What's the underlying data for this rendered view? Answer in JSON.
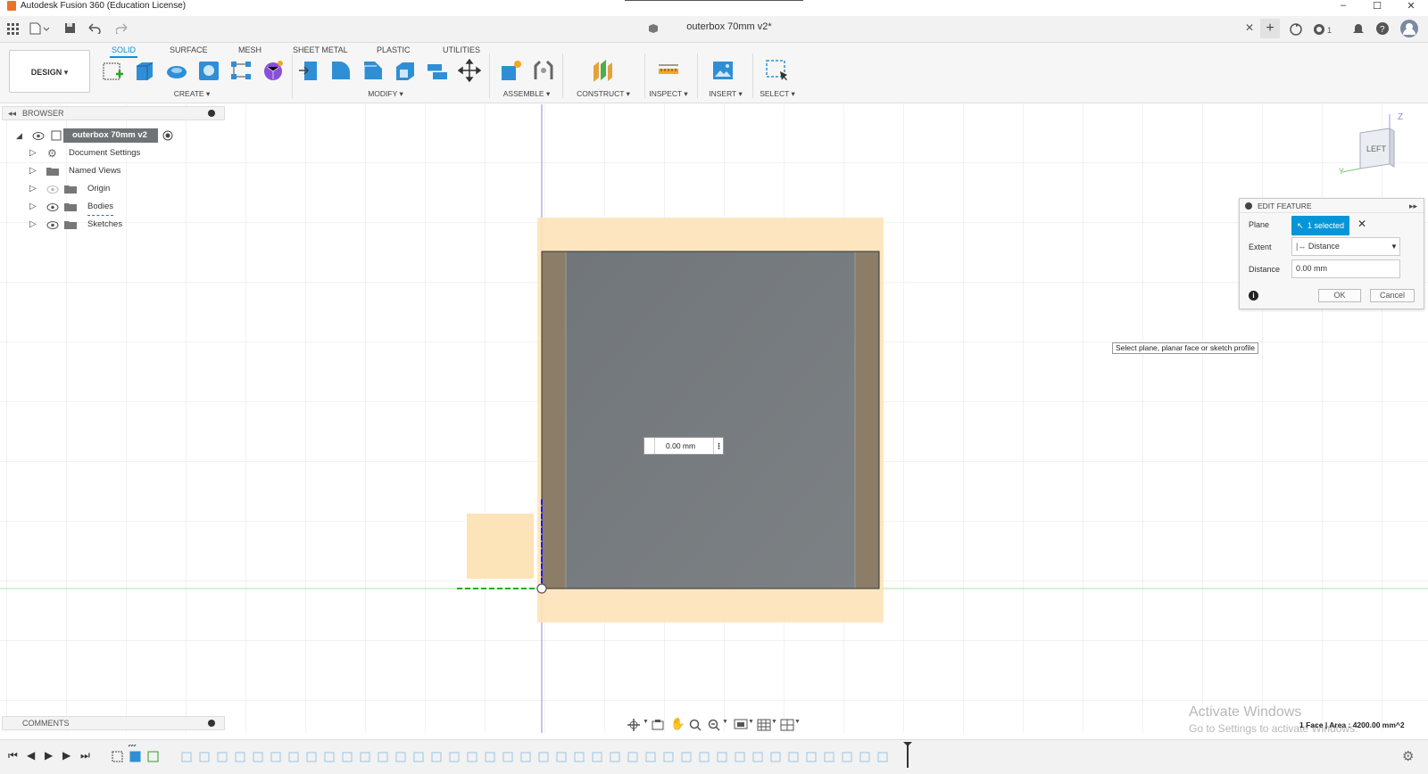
{
  "title_bar": {
    "title": "Autodesk Fusion 360 (Education License)"
  },
  "document_tab": {
    "name": "outerbox 70mm v2*"
  },
  "ribbon": {
    "workspace": "DESIGN",
    "tabs": [
      {
        "label": "SOLID",
        "active": true
      },
      {
        "label": "SURFACE",
        "active": false
      },
      {
        "label": "MESH",
        "active": false
      },
      {
        "label": "SHEET METAL",
        "active": false
      },
      {
        "label": "PLASTIC",
        "active": false
      },
      {
        "label": "UTILITIES",
        "active": false
      }
    ],
    "groups": [
      "CREATE",
      "MODIFY",
      "ASSEMBLE",
      "CONSTRUCT",
      "INSPECT",
      "INSERT",
      "SELECT"
    ]
  },
  "browser": {
    "header": "BROWSER",
    "root": "outerbox 70mm v2",
    "items": [
      "Document Settings",
      "Named Views",
      "Origin",
      "Bodies",
      "Sketches"
    ]
  },
  "comments": {
    "label": "COMMENTS"
  },
  "viewcube": {
    "face": "LEFT",
    "axis_z": "Z",
    "axis_y": "Y"
  },
  "edit_feature": {
    "title": "EDIT FEATURE",
    "plane_label": "Plane",
    "plane_value": "1 selected",
    "extent_label": "Extent",
    "extent_value": "Distance",
    "distance_label": "Distance",
    "distance_value": "0.00 mm",
    "ok": "OK",
    "cancel": "Cancel"
  },
  "tooltip": "Select plane, planar face or sketch profile",
  "dimension_input": "0.00 mm",
  "watermark": {
    "line1": "Activate Windows",
    "line2": "Go to Settings to activate Windows."
  },
  "status": "1 Face | Area : 4200.00 mm^2",
  "colors": {
    "accent": "#0696d7",
    "plane": "#fde3b8",
    "face": "#767b7d",
    "side": "#8c7d68"
  }
}
